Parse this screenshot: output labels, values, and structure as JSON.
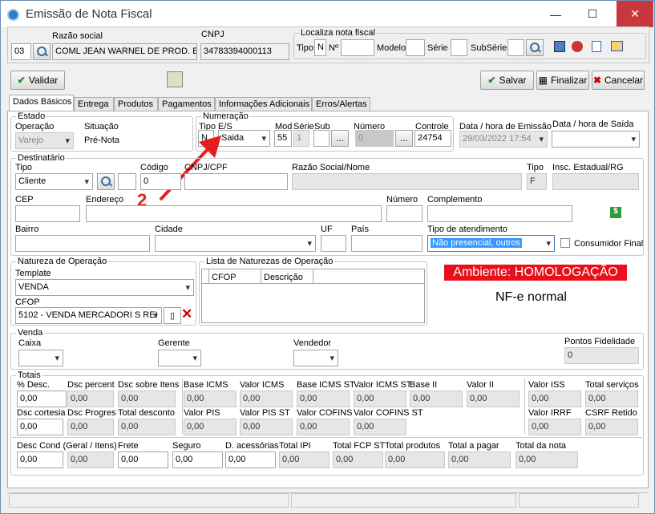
{
  "window": {
    "title": "Emissão de Nota Fiscal",
    "minimize": "—",
    "maximize": "☐",
    "close": "✕"
  },
  "header": {
    "code": "03",
    "razao_label": "Razão social",
    "razao_value": "COML JEAN WARNEL DE PROD. ESP.",
    "cnpj_label": "CNPJ",
    "cnpj_value": "34783394000113",
    "localiza_label": "Localiza nota fiscal",
    "tipo_label": "Tipo",
    "tipo_value": "N",
    "numero_label": "Nº",
    "modelo_label": "Modelo",
    "serie_label": "Série",
    "subserie_label": "SubSérie"
  },
  "toolbar": {
    "validar": "Validar",
    "salvar": "Salvar",
    "finalizar": "Finalizar",
    "cancelar": "Cancelar"
  },
  "tabs": [
    "Dados Básicos",
    "Entrega",
    "Produtos",
    "Pagamentos",
    "Informações Adicionais",
    "Erros/Alertas"
  ],
  "estado": {
    "title": "Estado",
    "operacao_label": "Operação",
    "operacao_value": "Varejo",
    "situacao_label": "Situação",
    "situacao_value": "Pré-Nota"
  },
  "numeracao": {
    "title": "Numeração",
    "tipo_label": "Tipo",
    "tipo_value": "N",
    "es_label": "E/S",
    "es_value": "Saida",
    "mod_label": "Mod",
    "mod_value": "55",
    "serie_label": "Série",
    "serie_value": "1",
    "sub_label": "Sub",
    "numero_label": "Número",
    "numero_value": "0",
    "controle_label": "Controle",
    "controle_value": "24754",
    "ellipsis": "..."
  },
  "datas": {
    "emissao_label": "Data / hora de Emissão",
    "emissao_value": "29/03/2022 17:54",
    "saida_label": "Data / hora de Saída"
  },
  "annotation": {
    "number": "2"
  },
  "destinatario": {
    "title": "Destinatário",
    "tipo_label": "Tipo",
    "tipo_value": "Cliente",
    "codigo_label": "Código",
    "codigo_value": "0",
    "cpf_label": "CNPJ/CPF",
    "razao_label": "Razão Social/Nome",
    "tipo2_label": "Tipo",
    "tipo2_value": "F",
    "insc_label": "Insc. Estadual/RG",
    "cep_label": "CEP",
    "endereco_label": "Endereço",
    "numero_label": "Número",
    "complemento_label": "Complemento",
    "bairro_label": "Bairro",
    "cidade_label": "Cidade",
    "uf_label": "UF",
    "pais_label": "País",
    "atendimento_label": "Tipo de atendimento",
    "atendimento_value": "Não presencial, outros",
    "consumidor_label": "Consumidor Final",
    "money_icon": "$"
  },
  "natureza": {
    "title": "Natureza de Operação",
    "template_label": "Template",
    "template_value": "VENDA",
    "cfop_label": "CFOP",
    "cfop_value": "5102  - VENDA MERCADORI S REI"
  },
  "lista": {
    "title": "Lista de Naturezas de Operação",
    "col1": "CFOP",
    "col2": "Descrição"
  },
  "ambiente": {
    "label": "Ambiente: HOMOLOGAÇÃO",
    "tipo": "NF-e normal",
    "color": "#e8101a"
  },
  "venda": {
    "title": "Venda",
    "caixa_label": "Caixa",
    "gerente_label": "Gerente",
    "vendedor_label": "Vendedor",
    "pontos_label": "Pontos Fidelidade",
    "pontos_value": "0"
  },
  "totais": {
    "title": "Totais",
    "row1": [
      {
        "label": "% Desc.",
        "value": "0,00"
      },
      {
        "label": "Dsc percent",
        "value": "0,00"
      },
      {
        "label": "Dsc sobre Itens",
        "value": "0,00"
      },
      {
        "label": "Base ICMS",
        "value": "0,00"
      },
      {
        "label": "Valor ICMS",
        "value": "0,00"
      },
      {
        "label": "Base ICMS ST",
        "value": "0,00"
      },
      {
        "label": "Valor ICMS ST",
        "value": "0,00"
      },
      {
        "label": "Base II",
        "value": "0,00"
      },
      {
        "label": "Valor II",
        "value": "0,00"
      },
      {
        "label": "Valor ISS",
        "value": "0,00"
      },
      {
        "label": "Total serviços",
        "value": "0,00"
      }
    ],
    "row2": [
      {
        "label": "Dsc cortesia",
        "value": "0,00"
      },
      {
        "label": "Dsc Progres",
        "value": "0,00"
      },
      {
        "label": "Total desconto",
        "value": "0,00"
      },
      {
        "label": "Valor PIS",
        "value": "0,00"
      },
      {
        "label": "Valor PIS ST",
        "value": "0,00"
      },
      {
        "label": "Valor COFINS",
        "value": "0,00"
      },
      {
        "label": "Valor COFINS ST",
        "value": "0,00"
      },
      {
        "label": "Valor IRRF",
        "value": "0,00"
      },
      {
        "label": "CSRF Retido",
        "value": "0,00"
      }
    ],
    "row3": [
      {
        "label": "Desc Cond (Geral / Itens)",
        "value": "0,00"
      },
      {
        "label": "",
        "value": "0,00"
      },
      {
        "label": "Frete",
        "value": "0,00"
      },
      {
        "label": "Seguro",
        "value": "0,00"
      },
      {
        "label": "D. acessórias",
        "value": "0,00"
      },
      {
        "label": "Total IPI",
        "value": "0,00"
      },
      {
        "label": "Total FCP ST",
        "value": "0,00"
      },
      {
        "label": "Total produtos",
        "value": "0,00"
      },
      {
        "label": "Total a pagar",
        "value": "0,00"
      },
      {
        "label": "Total da nota",
        "value": "0,00"
      }
    ]
  }
}
